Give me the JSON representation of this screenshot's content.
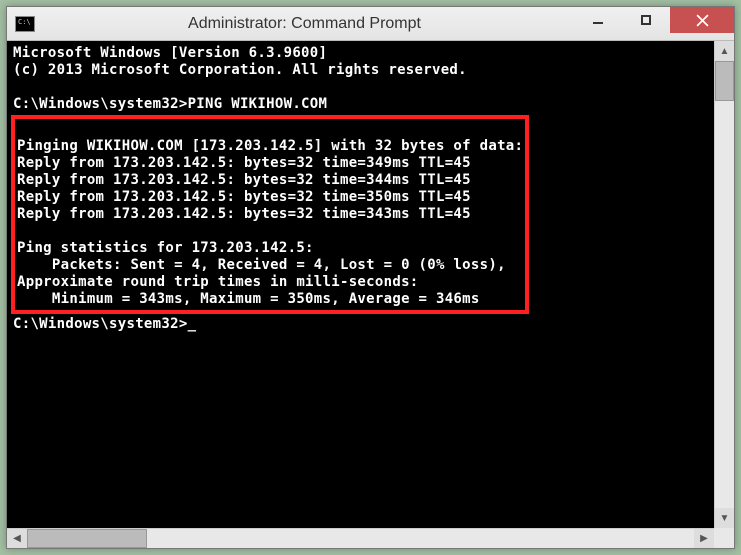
{
  "window": {
    "title": "Administrator: Command Prompt"
  },
  "console": {
    "header1": "Microsoft Windows [Version 6.3.9600]",
    "header2": "(c) 2013 Microsoft Corporation. All rights reserved.",
    "prompt1": "C:\\Windows\\system32>",
    "command1": "PING WIKIHOW.COM",
    "ping_header": "Pinging WIKIHOW.COM [173.203.142.5] with 32 bytes of data:",
    "reply1": "Reply from 173.203.142.5: bytes=32 time=349ms TTL=45",
    "reply2": "Reply from 173.203.142.5: bytes=32 time=344ms TTL=45",
    "reply3": "Reply from 173.203.142.5: bytes=32 time=350ms TTL=45",
    "reply4": "Reply from 173.203.142.5: bytes=32 time=343ms TTL=45",
    "stats_header": "Ping statistics for 173.203.142.5:",
    "stats_packets": "    Packets: Sent = 4, Received = 4, Lost = 0 (0% loss),",
    "rtt_header": "Approximate round trip times in milli-seconds:",
    "rtt_values": "    Minimum = 343ms, Maximum = 350ms, Average = 346ms",
    "prompt2": "C:\\Windows\\system32>"
  }
}
